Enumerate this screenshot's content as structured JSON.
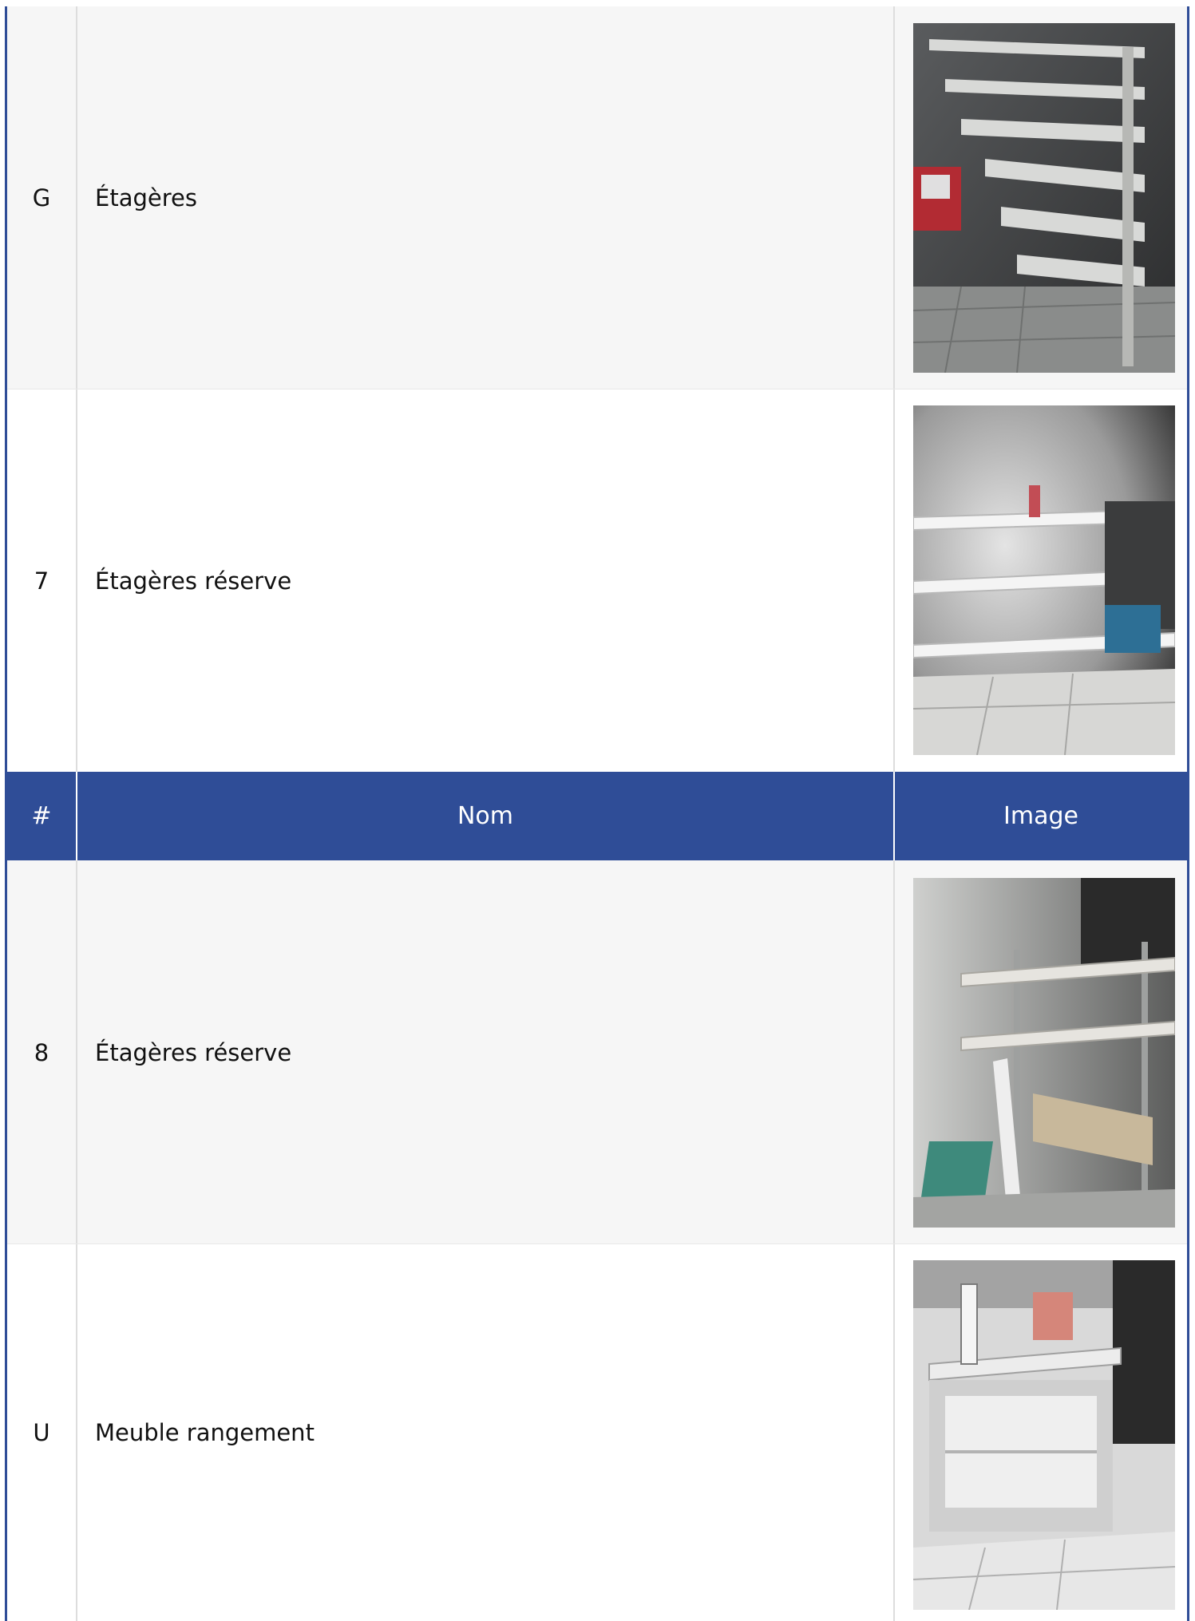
{
  "table": {
    "header": {
      "num": "#",
      "name": "Nom",
      "image": "Image"
    },
    "rows_before_header": [
      {
        "num": "G",
        "name": "Étagères",
        "image_icon": "shelving-photo"
      },
      {
        "num": "7",
        "name": "Étagères réserve",
        "image_icon": "storage-shelving-photo"
      }
    ],
    "rows_after_header": [
      {
        "num": "8",
        "name": "Étagères réserve",
        "image_icon": "storage-shelving-photo"
      },
      {
        "num": "U",
        "name": "Meuble rangement",
        "image_icon": "storage-cabinet-photo"
      }
    ]
  },
  "colors": {
    "header_bg": "#2f4d97",
    "header_text": "#ffffff",
    "row_alt_bg": "#f6f6f6",
    "border": "#2f4d97"
  }
}
